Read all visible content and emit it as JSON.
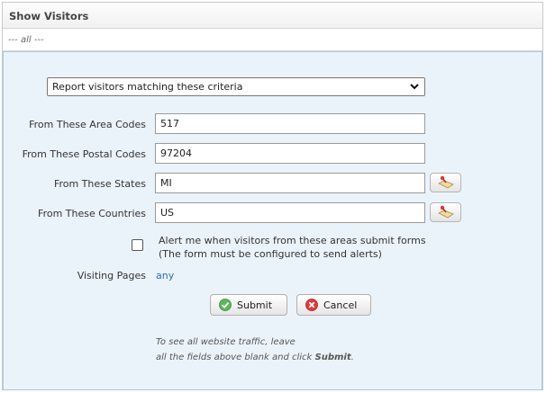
{
  "header": {
    "title": "Show Visitors"
  },
  "filter": {
    "value": "--- all ---"
  },
  "form": {
    "criteria_select": "Report visitors matching these criteria",
    "area_codes": {
      "label": "From These Area Codes",
      "value": "517"
    },
    "postal_codes": {
      "label": "From These Postal Codes",
      "value": "97204"
    },
    "states": {
      "label": "From These States",
      "value": "MI"
    },
    "countries": {
      "label": "From These Countries",
      "value": "US"
    },
    "alert": {
      "line1": "Alert me when visitors from these areas submit forms",
      "line2": "(The form must be configured to send alerts)",
      "checked": false
    },
    "visiting_pages": {
      "label": "Visiting Pages",
      "value": "any"
    },
    "submit_label": "Submit",
    "cancel_label": "Cancel",
    "note": {
      "line1": "To see all website traffic, leave",
      "line2_prefix": "all the fields above blank and click ",
      "line2_bold": "Submit",
      "line2_suffix": "."
    }
  },
  "colors": {
    "link": "#2a6fb0",
    "form_bg": "#ebf3fa",
    "form_border": "#a8c8e4"
  }
}
